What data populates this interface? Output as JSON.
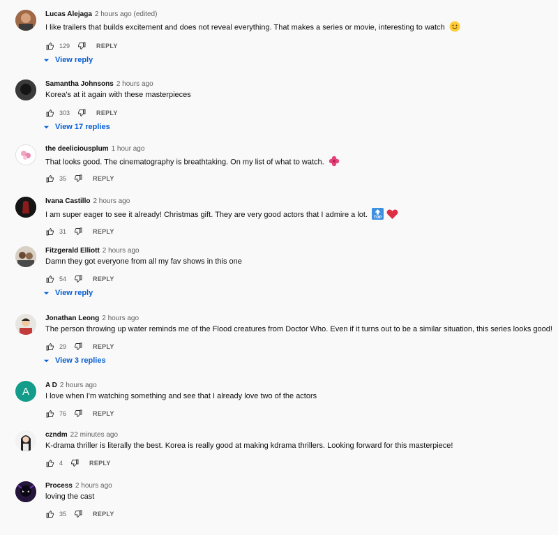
{
  "comments": [
    {
      "author": "Lucas Alejaga",
      "time": "2 hours ago (edited)",
      "text": "I like trailers that builds excitement and does not reveal everything. That makes a series or movie, interesting to watch",
      "emoji": "slightly-smiling-face",
      "likes": "129",
      "reply_label": "REPLY",
      "view_replies": "View reply"
    },
    {
      "author": "Samantha Johnsons",
      "time": "2 hours ago",
      "text": "Korea's at it again with these masterpieces",
      "likes": "303",
      "reply_label": "REPLY",
      "view_replies": "View 17 replies"
    },
    {
      "author": "the deeliciousplum",
      "time": "1 hour ago",
      "text": "That looks good. The cinematography is breathtaking. On my list of what to watch.",
      "emoji": "hibiscus",
      "likes": "35",
      "reply_label": "REPLY"
    },
    {
      "author": "Ivana Castillo",
      "time": "2 hours ago",
      "text": "I am super eager to see it already! Christmas gift. They are very good actors that I admire a lot.",
      "emoji": "top-arrow, red-heart",
      "likes": "31",
      "reply_label": "REPLY"
    },
    {
      "author": "Fitzgerald Elliott",
      "time": "2 hours ago",
      "text": "Damn they got everyone from all my fav shows in this one",
      "likes": "54",
      "reply_label": "REPLY",
      "view_replies": "View reply"
    },
    {
      "author": "Jonathan Leong",
      "time": "2 hours ago",
      "text": "The person throwing up water reminds me of the Flood creatures from Doctor Who. Even if it turns out to be a similar situation, this series looks good!",
      "likes": "29",
      "reply_label": "REPLY",
      "view_replies": "View 3 replies"
    },
    {
      "author": "A D",
      "time": "2 hours ago",
      "avatar_letter": "A",
      "text": "I love when I'm watching something and see that I already love two of the actors",
      "likes": "76",
      "reply_label": "REPLY"
    },
    {
      "author": "czndm",
      "time": "22 minutes ago",
      "text": "K-drama thriller is literally the best. Korea is really good at making kdrama thrillers. Looking forward for this masterpiece!",
      "likes": "4",
      "reply_label": "REPLY"
    },
    {
      "author": "Process",
      "time": "2 hours ago",
      "text": "loving the cast",
      "likes": "35",
      "reply_label": "REPLY"
    }
  ],
  "emoji_top_label": "TOP",
  "colors": {
    "link": "#065fd4",
    "muted": "#606060",
    "avatar_ad": "#139c8a"
  }
}
